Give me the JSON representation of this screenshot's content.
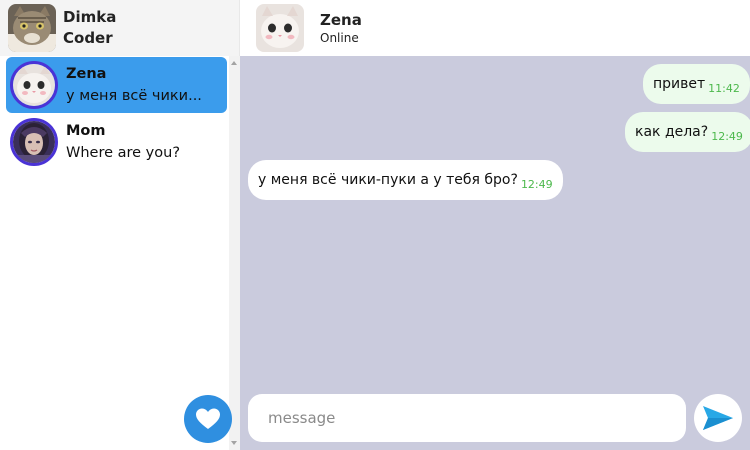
{
  "profile": {
    "name": "Dimka",
    "subtitle": "Coder",
    "avatar": "cat-avatar"
  },
  "chats": [
    {
      "name": "Zena",
      "preview": "у меня всё чики...",
      "active": true,
      "avatar": "white-cat-avatar"
    },
    {
      "name": "Mom",
      "preview": "Where are you?",
      "active": false,
      "avatar": "woman-avatar"
    }
  ],
  "fab": {
    "icon": "heart-icon"
  },
  "conversation": {
    "contact_name": "Zena",
    "status": "Online",
    "messages": [
      {
        "text": "привет",
        "time": "11:42",
        "direction": "outgoing"
      },
      {
        "text": "как дела?",
        "time": "12:49",
        "direction": "outgoing"
      },
      {
        "text": "у меня всё чики-пуки а у тебя бро?",
        "time": "12:49",
        "direction": "incoming"
      }
    ]
  },
  "composer": {
    "placeholder": "message",
    "value": ""
  },
  "send": {
    "icon": "paper-plane-icon"
  },
  "colors": {
    "active_chat": "#3b9cec",
    "avatar_ring": "#4a33d6",
    "chat_background": "#cacbdd",
    "outgoing_bubble": "#ecfbec",
    "timestamp": "#4cb84c",
    "fab": "#2f8fe0"
  }
}
